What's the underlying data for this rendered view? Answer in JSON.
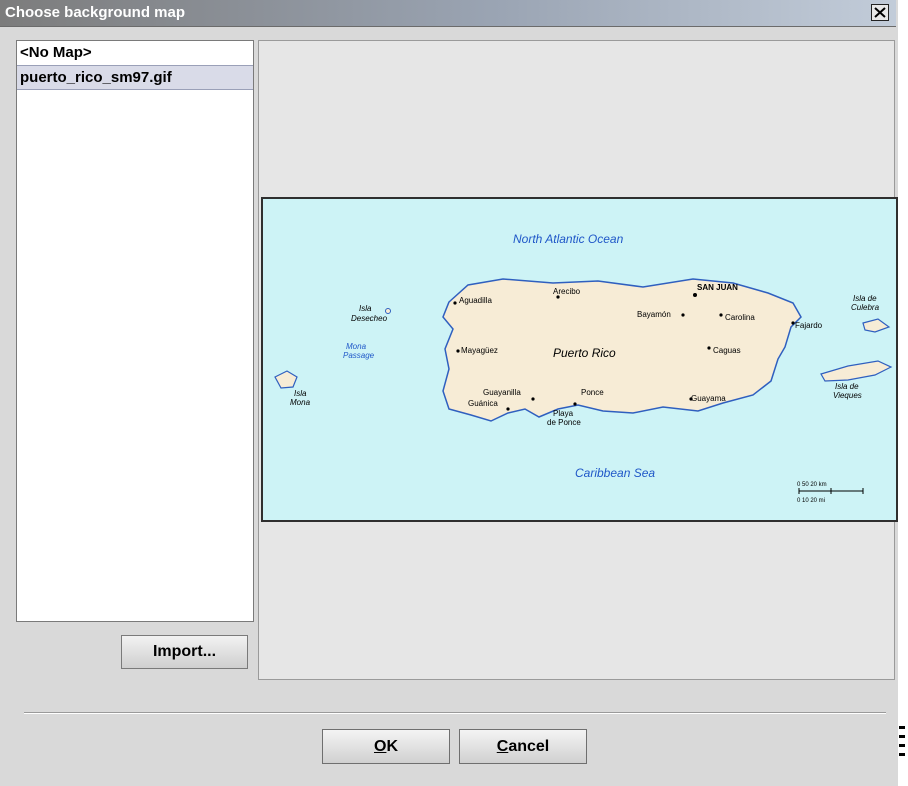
{
  "window": {
    "title": "Choose background map",
    "close_icon": "close-icon"
  },
  "map_list": {
    "items": [
      {
        "label": "<No Map>",
        "selected": false
      },
      {
        "label": "puerto_rico_sm97.gif",
        "selected": true
      }
    ]
  },
  "import_button": {
    "label": "Import..."
  },
  "preview": {
    "map_labels": {
      "ocean_north": "North   Atlantic   Ocean",
      "sea_south": "Caribbean   Sea",
      "island": "Puerto Rico",
      "isla_desecheo_1": "Isla",
      "isla_desecheo_2": "Desecheo",
      "mona_passage_1": "Mona",
      "mona_passage_2": "Passage",
      "isla_mona_1": "Isla",
      "isla_mona_2": "Mona",
      "isla_culebra_1": "Isla de",
      "isla_culebra_2": "Culebra",
      "isla_vieques_1": "Isla de",
      "isla_vieques_2": "Vieques",
      "aguadilla": "Aguadilla",
      "arecibo": "Arecibo",
      "san_juan": "SAN JUAN",
      "bayamon": "Bayamón",
      "carolina": "Carolina",
      "fajardo": "Fajardo",
      "mayaguez": "Mayagüez",
      "caguas": "Caguas",
      "guayanilla": "Guayanilla",
      "guanica": "Guánica",
      "ponce": "Ponce",
      "playa_1": "Playa",
      "playa_2": "de Ponce",
      "guayama": "Guayama",
      "scale_top": "0   50   20 km",
      "scale_bottom": "0      10      20 mi"
    }
  },
  "buttons": {
    "ok_mnemonic": "O",
    "ok_rest": "K",
    "cancel_mnemonic": "C",
    "cancel_rest": "ancel"
  },
  "colors": {
    "titlebar": "#9aa4b3",
    "map_water": "#cdf3f6",
    "map_land": "#f7ecd6",
    "selection": "#d9dbe8"
  }
}
